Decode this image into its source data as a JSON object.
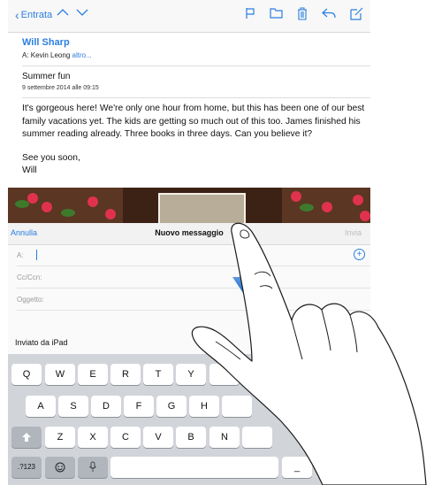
{
  "toolbar": {
    "back_label": "Entrata"
  },
  "mail": {
    "from": "Will Sharp",
    "to_prefix": "A:",
    "to_name": "Kevin Leong",
    "to_more": "altro...",
    "subject": "Summer fun",
    "date": "9 settembre 2014 alle 09:15",
    "paragraph1": "It's gorgeous here! We're only one hour from home, but this has been one of our best family vacations yet. The kids are getting so much out of this too. James finished his summer reading already. Three books in three days. Can you believe it?",
    "signoff_line1": "See you soon,",
    "signoff_line2": "Will"
  },
  "compose": {
    "cancel_label": "Annulla",
    "title": "Nuovo messaggio",
    "send_label": "Invia",
    "to_label": "A:",
    "cc_label": "Cc/Ccn:",
    "subject_label": "Oggetto:",
    "signature": "Inviato da iPad"
  },
  "keyboard": {
    "row1": [
      "Q",
      "W",
      "E",
      "R",
      "T",
      "Y"
    ],
    "row2": [
      "A",
      "S",
      "D",
      "F",
      "G",
      "H"
    ],
    "row3": [
      "Z",
      "X",
      "C",
      "V",
      "B",
      "N"
    ],
    "numbers_label": ".?123",
    "last_key": "_"
  },
  "colors": {
    "accent": "#2a7ee0",
    "arrow": "#1f6fd1"
  }
}
